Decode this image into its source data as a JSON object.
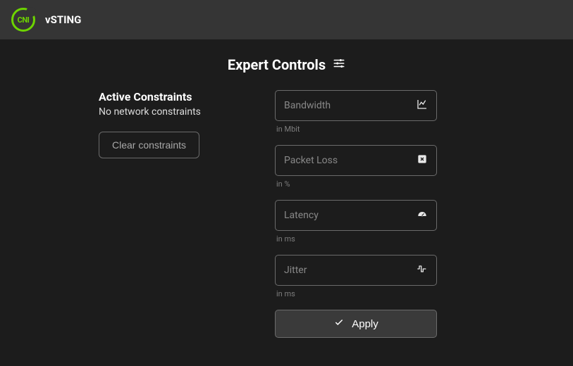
{
  "header": {
    "logo_text": "CNI",
    "app_name": "vSTING"
  },
  "page": {
    "title": "Expert Controls"
  },
  "constraints": {
    "heading": "Active Constraints",
    "status": "No network constraints",
    "clear_label": "Clear constraints"
  },
  "fields": {
    "bandwidth": {
      "placeholder": "Bandwidth",
      "help": "in Mbit",
      "value": ""
    },
    "packet_loss": {
      "placeholder": "Packet Loss",
      "help": "in %",
      "value": ""
    },
    "latency": {
      "placeholder": "Latency",
      "help": "in ms",
      "value": ""
    },
    "jitter": {
      "placeholder": "Jitter",
      "help": "in ms",
      "value": ""
    }
  },
  "actions": {
    "apply_label": "Apply"
  }
}
